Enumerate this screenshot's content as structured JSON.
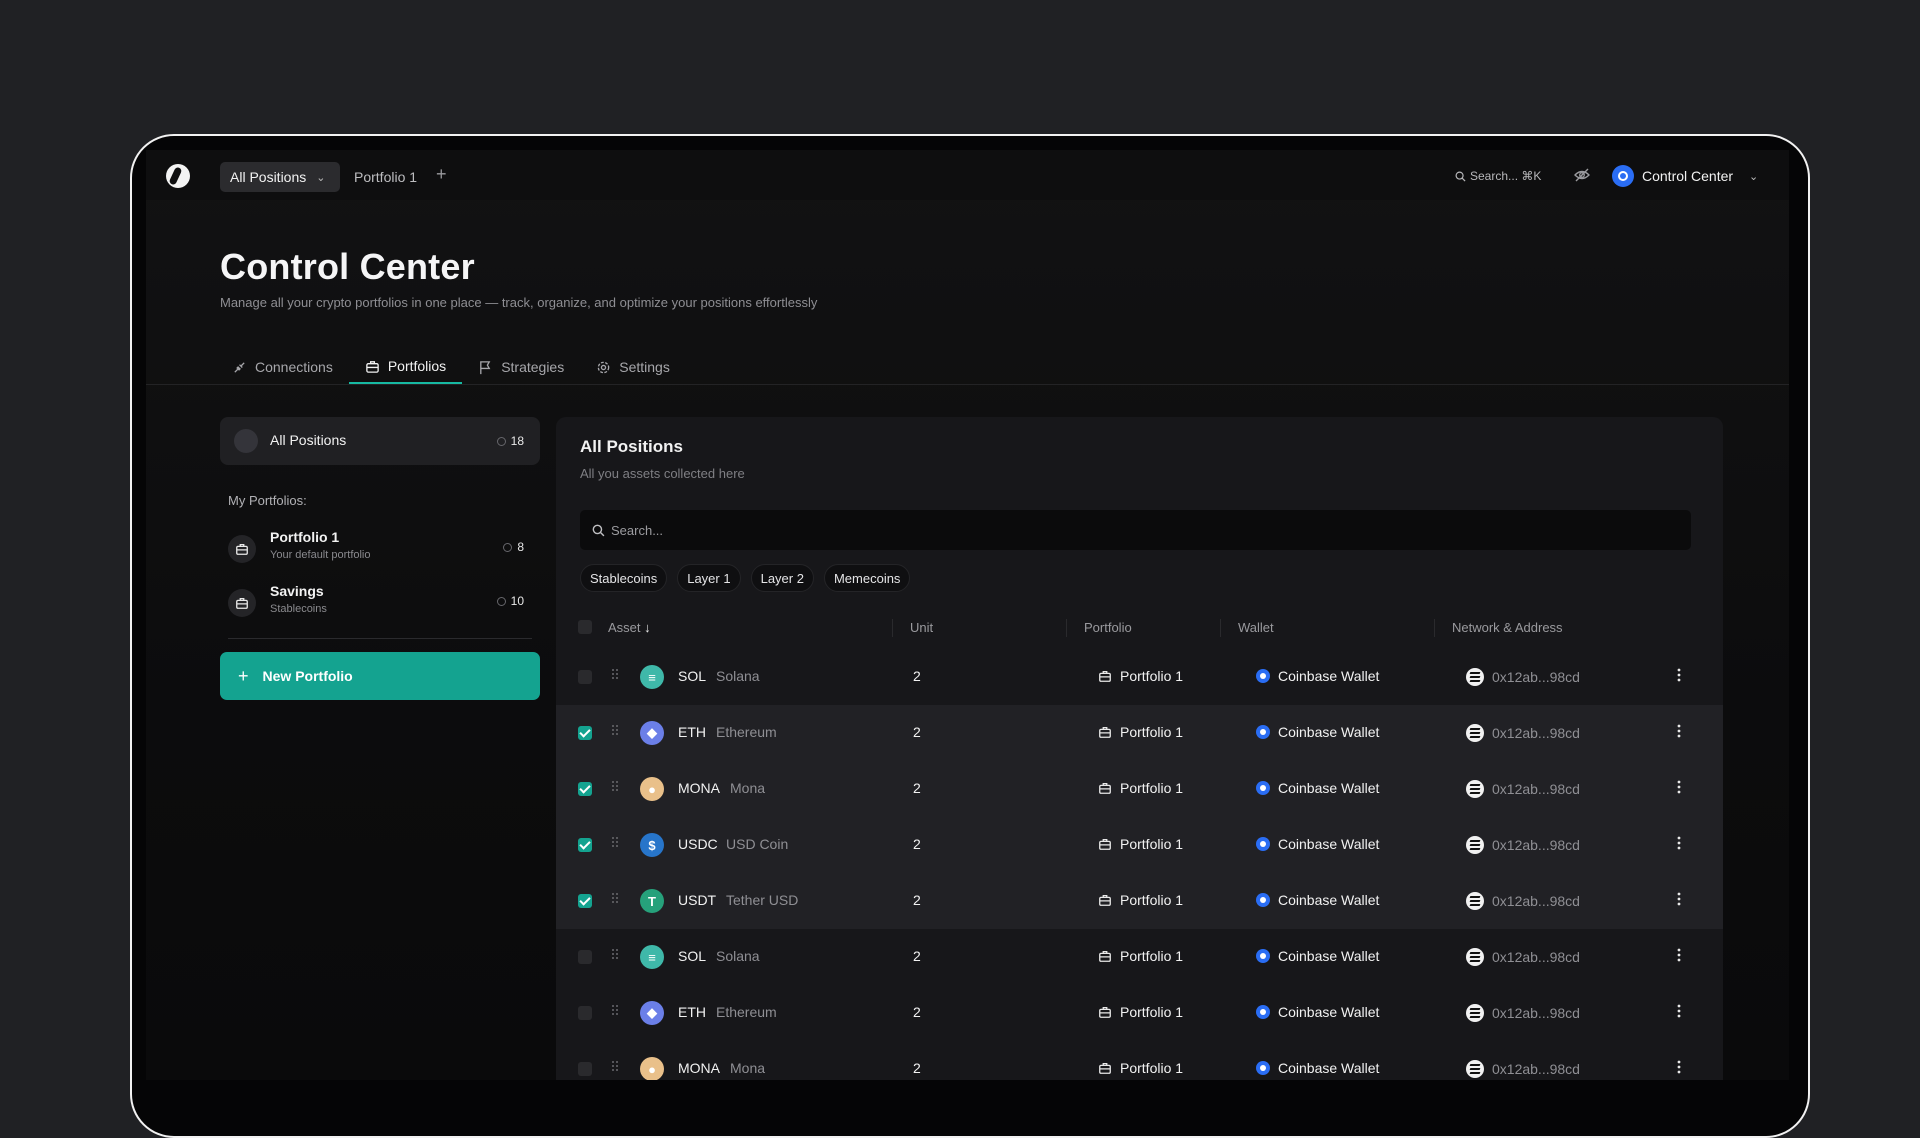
{
  "topbar": {
    "tab_all": "All Positions",
    "tab_p1": "Portfolio 1",
    "add": "+",
    "search": "Search... ⌘K",
    "account": "Control Center"
  },
  "header": {
    "title": "Control Center",
    "subtitle": "Manage all your crypto portfolios in one place — track, organize, and optimize your positions effortlessly"
  },
  "nav": {
    "tabs": [
      {
        "label": "Connections",
        "icon": "plug-icon"
      },
      {
        "label": "Portfolios",
        "icon": "briefcase-icon",
        "active": true
      },
      {
        "label": "Strategies",
        "icon": "flag-icon"
      },
      {
        "label": "Settings",
        "icon": "gear-icon"
      }
    ]
  },
  "sidebar": {
    "all": {
      "label": "All Positions",
      "count": "18"
    },
    "section_label": "My Portfolios:",
    "portfolios": [
      {
        "name": "Portfolio 1",
        "desc": "Your default portfolio",
        "count": "8"
      },
      {
        "name": "Savings",
        "desc": "Stablecoins",
        "count": "10"
      }
    ],
    "new_button": "New Portfolio"
  },
  "panel": {
    "title": "All Positions",
    "subtitle": "All you assets collected here",
    "search_placeholder": "Search...",
    "chips": [
      "Stablecoins",
      "Layer 1",
      "Layer 2",
      "Memecoins"
    ],
    "columns": [
      "Asset",
      "Unit",
      "Portfolio",
      "Wallet",
      "Network & Address"
    ],
    "rows": [
      {
        "symbol": "SOL",
        "name": "Solana",
        "unit": "2",
        "portfolio": "Portfolio 1",
        "wallet": "Coinbase Wallet",
        "address": "0x12ab...98cd",
        "checked": false,
        "color": "#3fb8a9"
      },
      {
        "symbol": "ETH",
        "name": "Ethereum",
        "unit": "2",
        "portfolio": "Portfolio 1",
        "wallet": "Coinbase Wallet",
        "address": "0x12ab...98cd",
        "checked": true,
        "color": "#6b7fe8"
      },
      {
        "symbol": "MONA",
        "name": "Mona",
        "unit": "2",
        "portfolio": "Portfolio 1",
        "wallet": "Coinbase Wallet",
        "address": "0x12ab...98cd",
        "checked": true,
        "color": "#e9c08a"
      },
      {
        "symbol": "USDC",
        "name": "USD Coin",
        "unit": "2",
        "portfolio": "Portfolio 1",
        "wallet": "Coinbase Wallet",
        "address": "0x12ab...98cd",
        "checked": true,
        "color": "#2775ca"
      },
      {
        "symbol": "USDT",
        "name": "Tether USD",
        "unit": "2",
        "portfolio": "Portfolio 1",
        "wallet": "Coinbase Wallet",
        "address": "0x12ab...98cd",
        "checked": true,
        "color": "#26a17b"
      },
      {
        "symbol": "SOL",
        "name": "Solana",
        "unit": "2",
        "portfolio": "Portfolio 1",
        "wallet": "Coinbase Wallet",
        "address": "0x12ab...98cd",
        "checked": false,
        "color": "#3fb8a9"
      },
      {
        "symbol": "ETH",
        "name": "Ethereum",
        "unit": "2",
        "portfolio": "Portfolio 1",
        "wallet": "Coinbase Wallet",
        "address": "0x12ab...98cd",
        "checked": false,
        "color": "#6b7fe8"
      },
      {
        "symbol": "MONA",
        "name": "Mona",
        "unit": "2",
        "portfolio": "Portfolio 1",
        "wallet": "Coinbase Wallet",
        "address": "0x12ab...98cd",
        "checked": false,
        "color": "#e9c08a"
      }
    ]
  },
  "colors": {
    "accent": "#14a390",
    "wallet_blue": "#2a6df4",
    "background": "#202124"
  }
}
